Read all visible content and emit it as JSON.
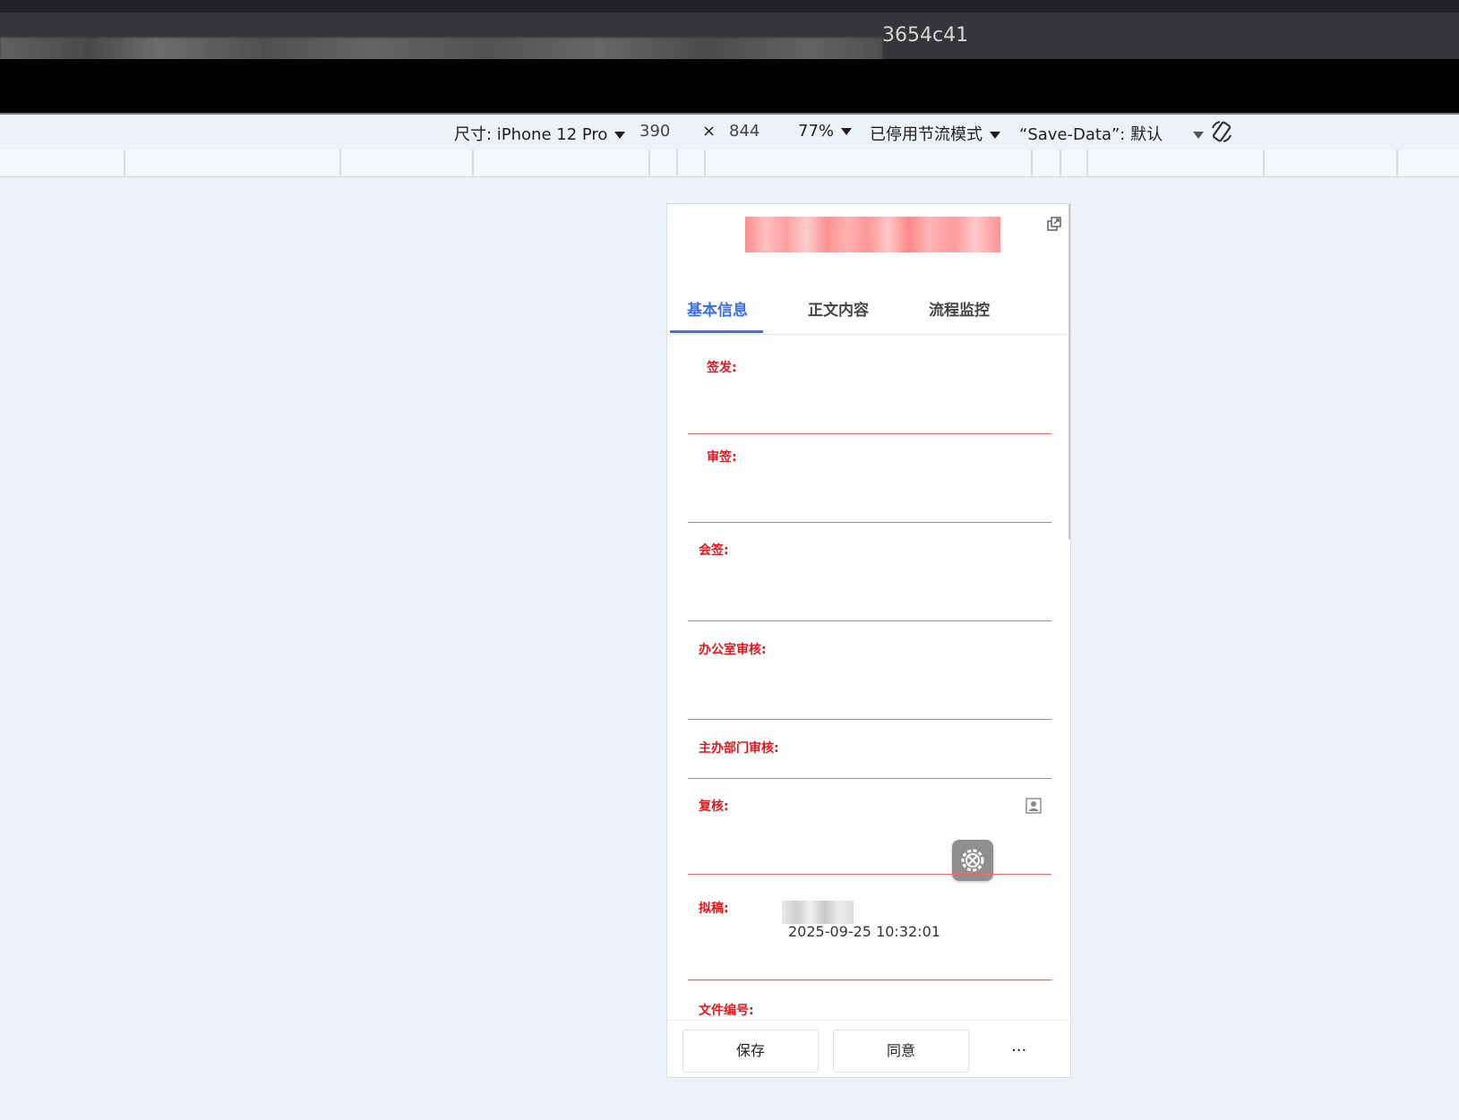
{
  "browser": {
    "url_visible_suffix": "3654c41"
  },
  "device_toolbar": {
    "dimensions_label": "尺寸: iPhone 12 Pro",
    "width": "390",
    "times": "×",
    "height": "844",
    "zoom": "77%",
    "throttling": "已停用节流模式",
    "save_data": "“Save-Data”: 默认"
  },
  "app": {
    "tabs": [
      {
        "label": "基本信息",
        "active": true
      },
      {
        "label": "正文内容",
        "active": false
      },
      {
        "label": "流程监控",
        "active": false
      }
    ],
    "fields": [
      {
        "label": "签发:"
      },
      {
        "label": "审签:"
      },
      {
        "label": "会签:"
      },
      {
        "label": "办公室审核:"
      },
      {
        "label": "主办部门审核:"
      },
      {
        "label": "复核:"
      },
      {
        "label": "拟稿:",
        "timestamp": "2025-09-25 10:32:01"
      },
      {
        "label": "文件编号:"
      }
    ],
    "footer": {
      "save_label": "保存",
      "agree_label": "同意",
      "more_label": "..."
    }
  },
  "colors": {
    "accent": "#3a6df0",
    "field_label": "#e8151b",
    "field_line": "#f06b6b"
  }
}
